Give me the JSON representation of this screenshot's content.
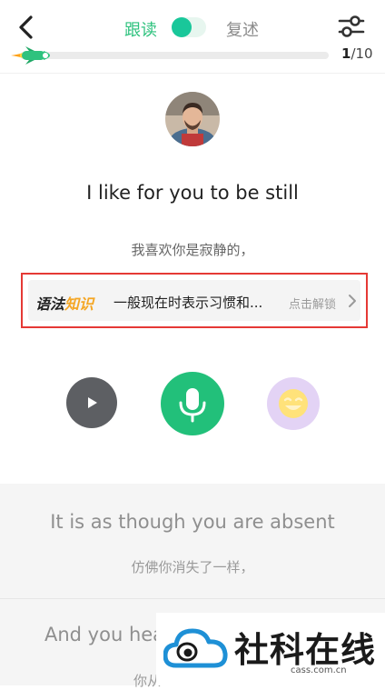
{
  "header": {
    "mode_read": "跟读",
    "mode_retell": "复述",
    "progress_current": "1",
    "progress_total": "/10",
    "progress_fraction": 0.1,
    "back_icon": "chevron-left-icon",
    "settings_icon": "sliders-icon"
  },
  "card": {
    "sentence": "I like for you to be still",
    "translation": "我喜欢你是寂静的，",
    "grammar": {
      "tag_part1": "语法",
      "tag_part2": "知识",
      "text": "一般现在时表示习惯和...",
      "unlock_label": "点击解锁"
    }
  },
  "actions": {
    "play_icon": "play-icon",
    "mic_icon": "microphone-icon",
    "emoji_icon": "laughing-face-icon"
  },
  "list": [
    {
      "sentence": "It is as though you are absent",
      "translation": "仿佛你消失了一样，"
    },
    {
      "sentence": "And you hea",
      "translation": "你从"
    }
  ],
  "watermark": {
    "title": "社科在线",
    "subtitle": "cass.com.cn"
  },
  "colors": {
    "accent_green": "#2ec27e",
    "mic_green": "#22c07a",
    "highlight_red": "#e53935",
    "tag_orange": "#f5a623",
    "emoji_purple": "#e3d3f5"
  }
}
